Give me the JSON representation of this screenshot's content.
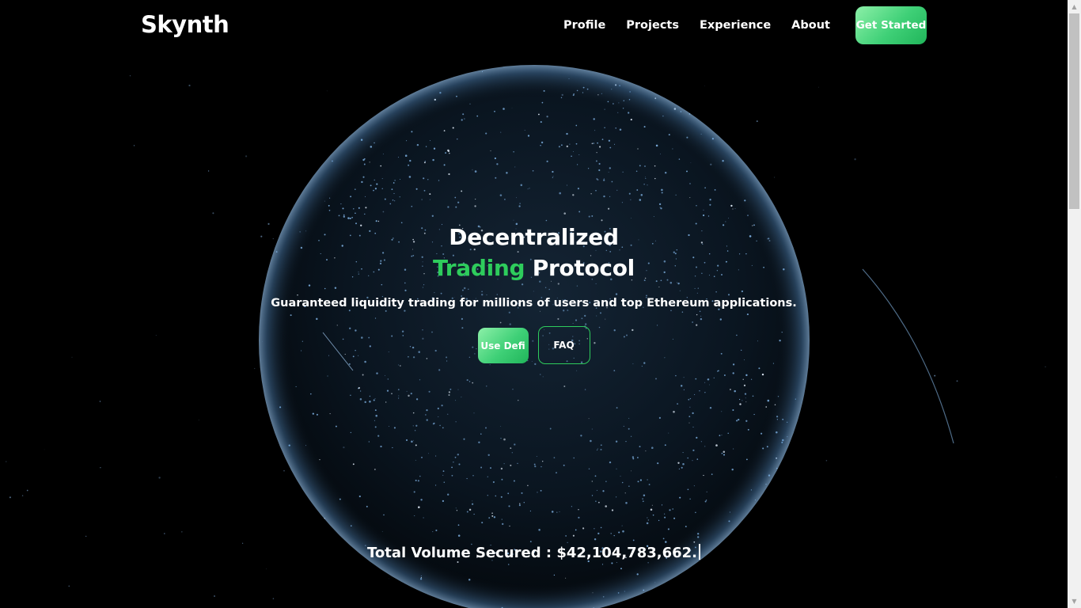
{
  "brand": "Skynth",
  "nav": {
    "links": [
      "Profile",
      "Projects",
      "Experience",
      "About"
    ],
    "cta_label": "Get Started"
  },
  "hero": {
    "title_line1": "Decentralized",
    "title_accent": "Trading",
    "title_rest": "Protocol",
    "subtitle": "Guaranteed liquidity trading for millions of users and top Ethereum applications.",
    "primary_button": "Use Defi",
    "secondary_button": "FAQ"
  },
  "stats": {
    "volume_label": "Total Volume Secured :",
    "volume_value": "$42,104,783,662."
  },
  "colors": {
    "accent": "#2ecc5c",
    "button_gradient_start": "#8cf0a8",
    "button_gradient_end": "#20b55a",
    "background": "#000000",
    "globe_glow": "#6aa8e6"
  },
  "icons": {
    "scroll_up": "triangle-up-icon",
    "scroll_down": "triangle-down-icon"
  }
}
